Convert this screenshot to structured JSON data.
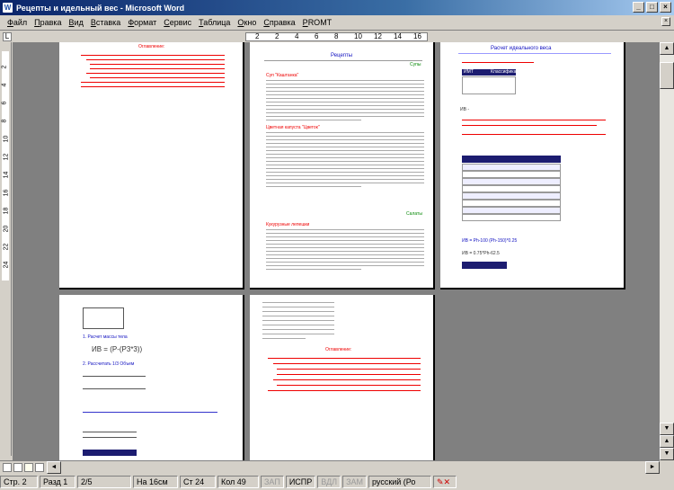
{
  "window": {
    "title": "Рецепты и идельный вес - Microsoft Word"
  },
  "menu": {
    "items": [
      {
        "label": "Файл",
        "u": "Ф",
        "rest": "айл"
      },
      {
        "label": "Правка",
        "u": "П",
        "rest": "равка"
      },
      {
        "label": "Вид",
        "u": "В",
        "rest": "ид"
      },
      {
        "label": "Вставка",
        "u": "В",
        "rest": "ставка"
      },
      {
        "label": "Формат",
        "u": "Ф",
        "rest": "ормат"
      },
      {
        "label": "Сервис",
        "u": "С",
        "rest": "ервис"
      },
      {
        "label": "Таблица",
        "u": "Т",
        "rest": "аблица"
      },
      {
        "label": "Окно",
        "u": "О",
        "rest": "кно"
      },
      {
        "label": "Справка",
        "u": "С",
        "rest": "правка"
      },
      {
        "label": "PROMT",
        "u": "P",
        "rest": "ROMT"
      }
    ]
  },
  "ruler": {
    "numbers": [
      "2",
      "2",
      "4",
      "6",
      "8",
      "10",
      "12",
      "14",
      "16"
    ]
  },
  "vruler": {
    "numbers": [
      "2",
      "4",
      "6",
      "8",
      "10",
      "12",
      "14",
      "16",
      "18",
      "20",
      "22",
      "24"
    ]
  },
  "pages": {
    "p2_title": "Рецепты",
    "p2_h1": "Суп \"Каштанка\"",
    "p2_h2": "Цветная капуста \"Цветок\"",
    "p2_h3": "Кукурузные лепешки",
    "p2_tag1": "Супы",
    "p2_tag2": "Салаты",
    "p3_title": "Расчет идеального веса",
    "p3_headers": [
      "ИМТ",
      "Классификация"
    ],
    "p3_values": [
      "18",
      "20",
      "24"
    ],
    "p3_formula1": "ИВ = Ph-100 (Ph-150)*0.25",
    "p3_formula2": "ИВ = 0.75*Ph-62.5",
    "p3_f_label": "ИВ -",
    "p4_formula": "ИВ = (Р-(Р3*3))",
    "p4_head1": "1. Расчет массы тела",
    "p4_head2": "2. Рассчитать 1/3 Объем",
    "p5_toc_title": "Оглавление:"
  },
  "status": {
    "page": "Стр. 2",
    "section": "Разд 1",
    "pages": "2/5",
    "at": "На 16см",
    "line": "Ст 24",
    "col": "Кол 49",
    "rec": "ЗАП",
    "trk": "ИСПР",
    "ext": "ВДЛ",
    "ovr": "ЗАМ",
    "lang": "русский (Ро"
  }
}
